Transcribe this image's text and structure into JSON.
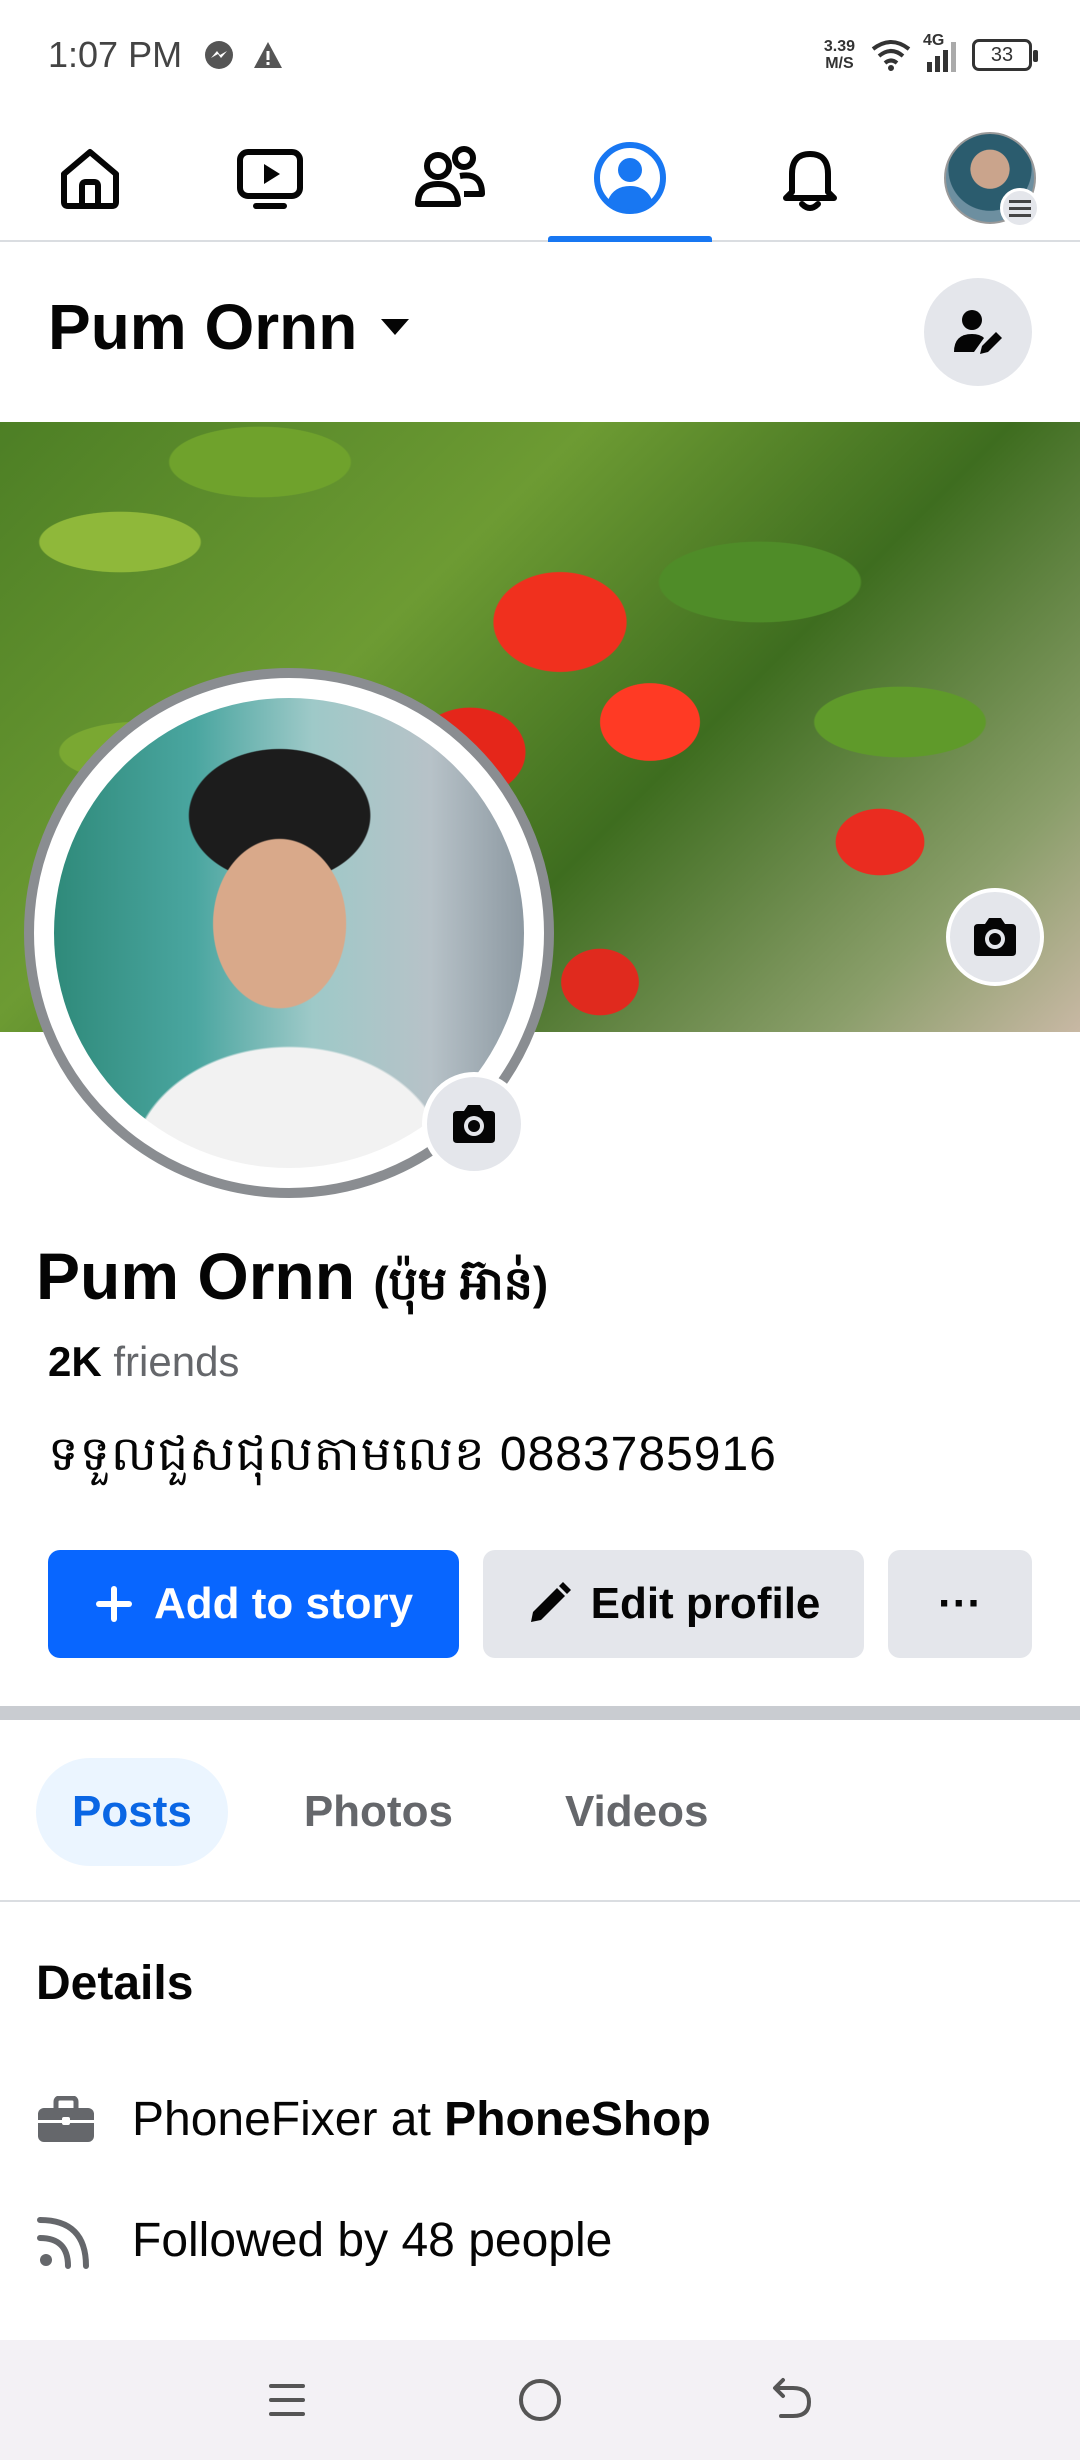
{
  "status_bar": {
    "time": "1:07 PM",
    "net_speed_value": "3.39",
    "net_speed_unit": "M/S",
    "network": "4G",
    "battery": "33",
    "left_icons": [
      "messenger-icon",
      "warning-icon"
    ],
    "right_icons": [
      "wifi-icon",
      "signal-icon",
      "battery-icon"
    ]
  },
  "top_nav": {
    "items": [
      {
        "name": "home",
        "icon": "home-icon"
      },
      {
        "name": "video",
        "icon": "video-icon"
      },
      {
        "name": "friends",
        "icon": "friends-icon"
      },
      {
        "name": "profile",
        "icon": "profile-icon",
        "active": true
      },
      {
        "name": "notifications",
        "icon": "bell-icon"
      },
      {
        "name": "menu",
        "icon": "avatar-menu-icon"
      }
    ]
  },
  "header": {
    "title": "Pum Ornn"
  },
  "profile": {
    "name": "Pum Ornn",
    "alternate_name": "(ប៉ុម អ៊ាន់)",
    "friends_count": "2K",
    "friends_label": "friends",
    "bio": "ទទួលជួសជុលតាមលេខ 0883785916"
  },
  "actions": {
    "add_story": "Add to story",
    "edit_profile": "Edit profile",
    "more": "···"
  },
  "tabs": [
    {
      "label": "Posts",
      "active": true
    },
    {
      "label": "Photos",
      "active": false
    },
    {
      "label": "Videos",
      "active": false
    }
  ],
  "details": {
    "title": "Details",
    "work_prefix": "PhoneFixer at ",
    "work_place": "PhoneShop",
    "followers": "Followed by 48 people"
  },
  "colors": {
    "accent": "#0866ff",
    "tab_active_bg": "#ebf5ff",
    "button_gray": "#e4e6eb",
    "secondary_text": "#65676b"
  }
}
